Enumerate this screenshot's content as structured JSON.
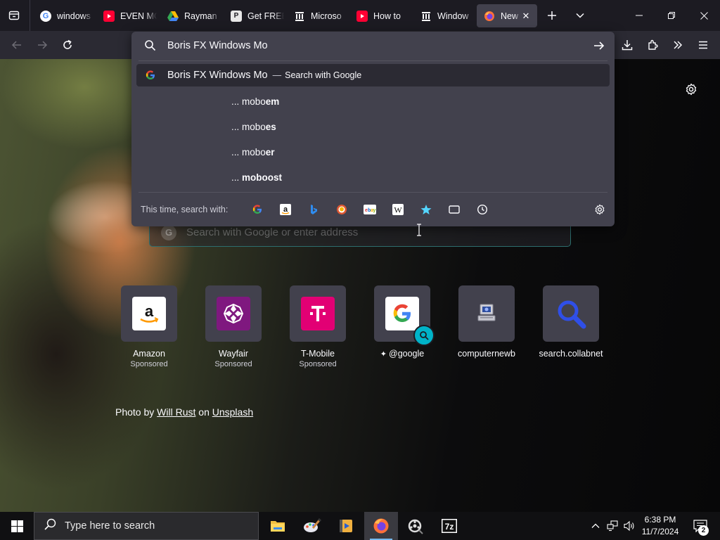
{
  "tabs": [
    {
      "title": "windows",
      "favicon": "google-icon",
      "active": false
    },
    {
      "title": "EVEN MO",
      "favicon": "youtube-icon",
      "active": false
    },
    {
      "title": "Rayman",
      "favicon": "google-drive-icon",
      "active": false
    },
    {
      "title": "Get FREE",
      "favicon": "p-logo-icon",
      "active": false
    },
    {
      "title": "Microso",
      "favicon": "building-icon",
      "active": false
    },
    {
      "title": "How to",
      "favicon": "youtube-icon",
      "active": false
    },
    {
      "title": "Window",
      "favicon": "building-icon",
      "active": false
    },
    {
      "title": "New T",
      "favicon": "firefox-icon",
      "active": true
    }
  ],
  "urlbar": {
    "value": "Boris FX Windows Mo",
    "heuristic": {
      "query": "Boris FX Windows Mo",
      "separator": "—",
      "action": "Search with Google"
    },
    "suggestions": [
      {
        "prefix": "... mobo",
        "rest": "em"
      },
      {
        "prefix": "... mobo",
        "rest": "es"
      },
      {
        "prefix": "... mobo",
        "rest": "er"
      },
      {
        "prefix": "... ",
        "rest": "moboost"
      }
    ],
    "oneoff_label": "This time, search with:",
    "engines": [
      "google-icon",
      "amazon-icon",
      "bing-icon",
      "duckduckgo-icon",
      "ebay-icon",
      "wikipedia-icon",
      "bookmarks-star-icon",
      "tabs-icon",
      "history-clock-icon"
    ]
  },
  "newtab": {
    "search_placeholder": "Search with Google or enter address",
    "shortcuts": [
      {
        "name": "Amazon",
        "sponsored": "Sponsored"
      },
      {
        "name": "Wayfair",
        "sponsored": "Sponsored"
      },
      {
        "name": "T-Mobile",
        "sponsored": "Sponsored"
      },
      {
        "name": "@google",
        "sponsored": ""
      },
      {
        "name": "computernewb",
        "sponsored": ""
      },
      {
        "name": "search.collabnet",
        "sponsored": ""
      }
    ],
    "credit": {
      "prefix": "Photo by",
      "author": "Will Rust",
      "middle": "on",
      "source": "Unsplash"
    }
  },
  "taskbar": {
    "search_placeholder": "Type here to search",
    "apps": [
      "file-explorer-icon",
      "paint-icon",
      "media-player-icon",
      "firefox-icon",
      "media-classic-icon",
      "7zip-icon"
    ],
    "time": "6:38 PM",
    "date": "11/7/2024",
    "notifications": "2"
  },
  "colors": {
    "accent": "#00b3c8",
    "toolbar": "#2b2a33",
    "popup": "#42414d",
    "tabstrip": "#1c1b22"
  }
}
